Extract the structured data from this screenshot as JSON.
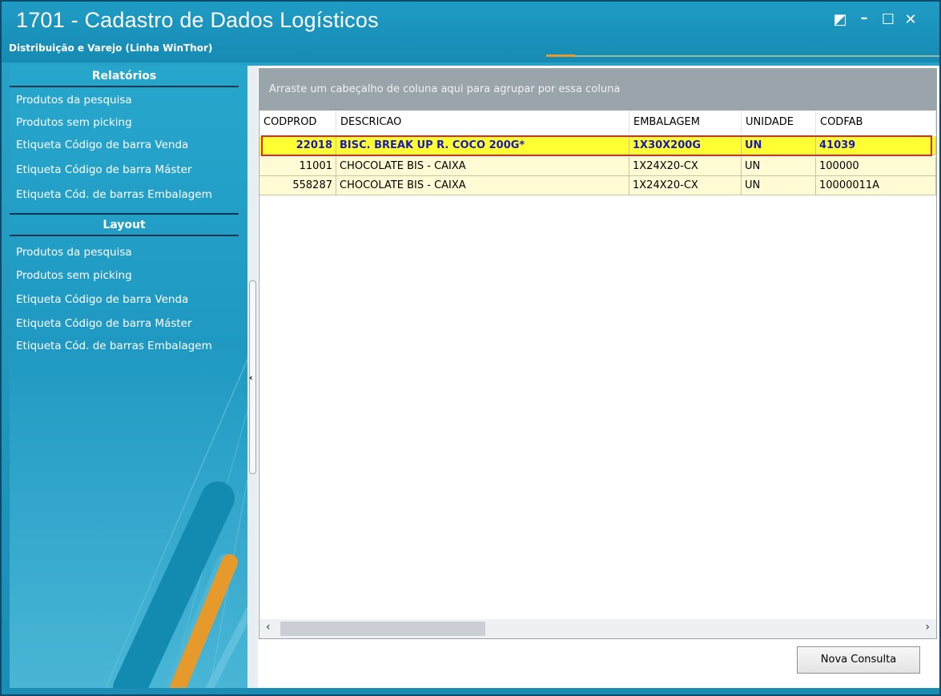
{
  "window": {
    "title": "1701 - Cadastro de Dados Logísticos",
    "subtitle": "Distribuição e Varejo (Linha WinThor)",
    "controls": {
      "restore": "◩",
      "minimize": "–",
      "maximize": "☐",
      "close": "✕"
    }
  },
  "sidebar": {
    "relatorios": {
      "title": "Relatórios",
      "items": [
        "Produtos da pesquisa",
        "Produtos sem picking",
        "Etiqueta Código de barra Venda",
        "Etiqueta Código de barra Máster",
        "Etiqueta Cód. de barras Embalagem"
      ]
    },
    "layout": {
      "title": "Layout",
      "items": [
        "Produtos da pesquisa",
        "Produtos sem picking",
        "Etiqueta Código de barra Venda",
        "Etiqueta Código de barra Máster",
        "Etiqueta Cód. de barras Embalagem"
      ]
    }
  },
  "splitter": {
    "arrow": "‹"
  },
  "grid": {
    "group_hint": "Arraste um cabeçalho de coluna aqui para agrupar por essa coluna",
    "columns": [
      "CODPROD",
      "DESCRICAO",
      "EMBALAGEM",
      "UNIDADE",
      "CODFAB"
    ],
    "rows": [
      [
        "22018",
        "BISC. BREAK UP R. COCO 200G*",
        "1X30X200G",
        "UN",
        "41039"
      ],
      [
        "11001",
        "CHOCOLATE BIS  - CAIXA",
        "1X24X20-CX",
        "UN",
        "100000"
      ],
      [
        "558287",
        "CHOCOLATE BIS  - CAIXA",
        "1X24X20-CX",
        "UN",
        "10000011A"
      ]
    ],
    "selected_row": 0,
    "scroll": {
      "left": "‹",
      "right": "›"
    }
  },
  "buttons": {
    "nova_consulta": "Nova Consulta"
  },
  "colors": {
    "titlebar": "#1f9cc4",
    "accent_orange": "#e79a2c",
    "selected_row": "#ffff33",
    "selected_text": "#1a1ab8",
    "row_bg": "#fffbd4",
    "selection_border": "#e02a2a"
  }
}
